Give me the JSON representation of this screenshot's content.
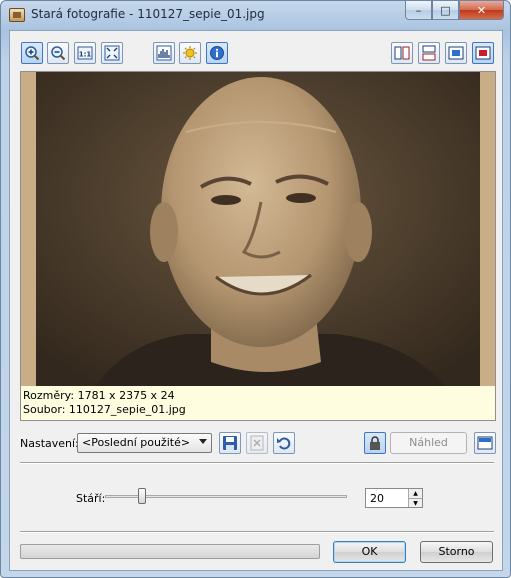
{
  "window": {
    "title": "Stará fotografie - 110127_sepie_01.jpg",
    "buttons": {
      "minimize": "–",
      "maximize": "□",
      "close": "✕"
    }
  },
  "toolbar": {
    "left_icons": [
      "zoom-in-icon",
      "zoom-out-icon",
      "actual-size-icon",
      "fit-to-window-icon",
      "histogram-icon",
      "sun-icon",
      "info-icon"
    ],
    "right_icons": [
      "split-vertical-icon",
      "split-horizontal-icon",
      "single-view-icon",
      "original-view-icon"
    ]
  },
  "info": {
    "dimensions": "Rozměry: 1781 x 2375 x 24",
    "file": "Soubor: 110127_sepie_01.jpg"
  },
  "settings": {
    "label": "Nastavení:",
    "selected": "<Poslední použité>",
    "preview_button": "Náhled"
  },
  "age": {
    "label": "Stáří:",
    "value": "20",
    "slider_fraction": 0.2
  },
  "footer": {
    "ok": "OK",
    "cancel": "Storno",
    "progress_fraction": 0
  },
  "colors": {
    "accent": "#3c7fb1",
    "info_bg": "#fffde0",
    "sepia_bg": "#c9ad87"
  }
}
